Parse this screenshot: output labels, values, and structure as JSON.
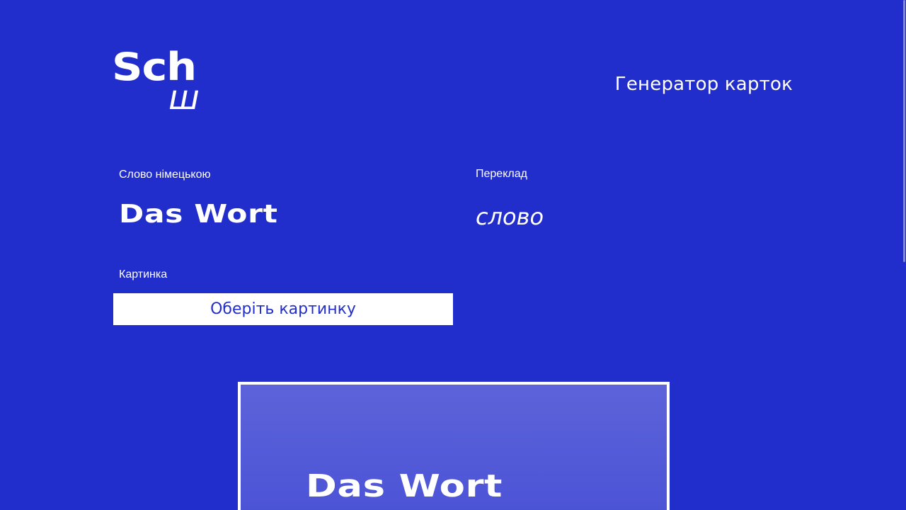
{
  "logo": {
    "top_text": "Sch",
    "bottom_text": "ш"
  },
  "header": {
    "title": "Генератор карток"
  },
  "form": {
    "german_word": {
      "label": "Слово німецькою",
      "value": "Das Wort"
    },
    "translation": {
      "label": "Переклад",
      "value": "слово"
    },
    "image": {
      "label": "Картинка",
      "button_label": "Оберіть картинку"
    }
  },
  "card": {
    "word": "Das Wort"
  },
  "colors": {
    "background": "#222ecb",
    "text": "#ffffff",
    "button_bg": "#ffffff",
    "button_text": "#222ecb",
    "card_gradient_top": "#5d63d9",
    "card_gradient_bottom": "#4a52d6"
  }
}
